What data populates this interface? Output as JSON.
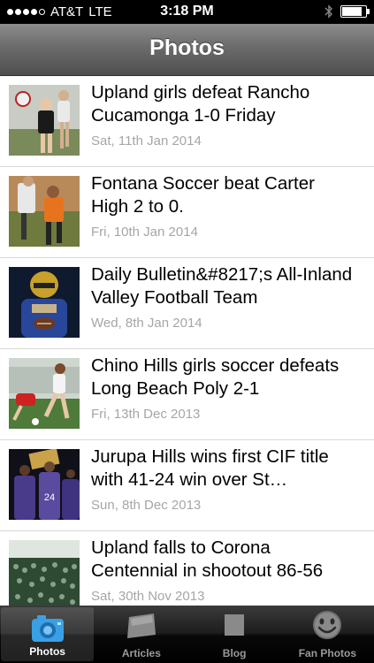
{
  "status_bar": {
    "carrier": "AT&T",
    "network": "LTE",
    "time": "3:18 PM",
    "signal_bars": 4,
    "signal_max": 5,
    "battery_level": 0.85
  },
  "nav": {
    "title": "Photos"
  },
  "articles": [
    {
      "title": "Upland girls defeat Rancho Cucamonga 1-0 Friday",
      "date": "Sat, 11th Jan 2014"
    },
    {
      "title": "Fontana Soccer beat Carter High 2 to 0.",
      "date": "Fri, 10th Jan 2014"
    },
    {
      "title": "Daily Bulletin&#8217;s All-Inland Valley Football Team",
      "date": "Wed, 8th Jan 2014"
    },
    {
      "title": "Chino Hills girls soccer defeats Long Beach Poly 2-1",
      "date": "Fri, 13th Dec 2013"
    },
    {
      "title": "Jurupa Hills wins first CIF title with 41-24 win over St…",
      "date": "Sun, 8th Dec 2013"
    },
    {
      "title": "Upland falls to Corona Centennial in shootout 86-56",
      "date": "Sat, 30th Nov 2013"
    }
  ],
  "tabs": [
    {
      "label": "Photos",
      "icon": "camera-icon",
      "active": true
    },
    {
      "label": "Articles",
      "icon": "newspaper-icon",
      "active": false
    },
    {
      "label": "Blog",
      "icon": "blog-icon",
      "active": false
    },
    {
      "label": "Fan Photos",
      "icon": "smiley-icon",
      "active": false
    }
  ],
  "colors": {
    "tab_active_icon": "#3aa0e6",
    "date_text": "#a6a6a6",
    "nav_bar": "#6b6b6b"
  }
}
